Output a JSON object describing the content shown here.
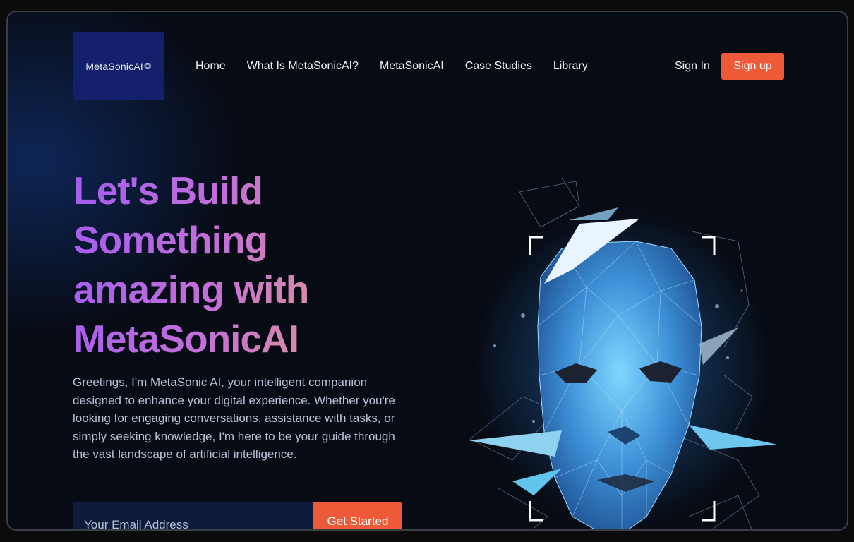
{
  "header": {
    "logo_text": "MetaSonicAI",
    "logo_icon": "globe-icon",
    "nav": [
      "Home",
      "What Is MetaSonicAI?",
      "MetaSonicAI",
      "Case Studies",
      "Library"
    ],
    "sign_in": "Sign In",
    "sign_up": "Sign up"
  },
  "hero": {
    "title_lines": [
      "Let's Build",
      "Something",
      "amazing with",
      "MetaSonicAI"
    ],
    "description": "Greetings, I'm MetaSonic AI, your intelligent companion designed to enhance your digital experience. Whether you're looking for engaging conversations, assistance with tasks, or simply seeking knowledge, I'm here to be your guide through the vast landscape of artificial intelligence.",
    "email_placeholder": "Your Email Address",
    "cta": "Get Started"
  },
  "colors": {
    "accent": "#ee5a37",
    "logo_bg": "#14206b",
    "background": "#070b14",
    "title_gradient_start": "#a35cf0",
    "title_gradient_end": "#e3a08c"
  },
  "illustration": "low-poly-ai-face"
}
